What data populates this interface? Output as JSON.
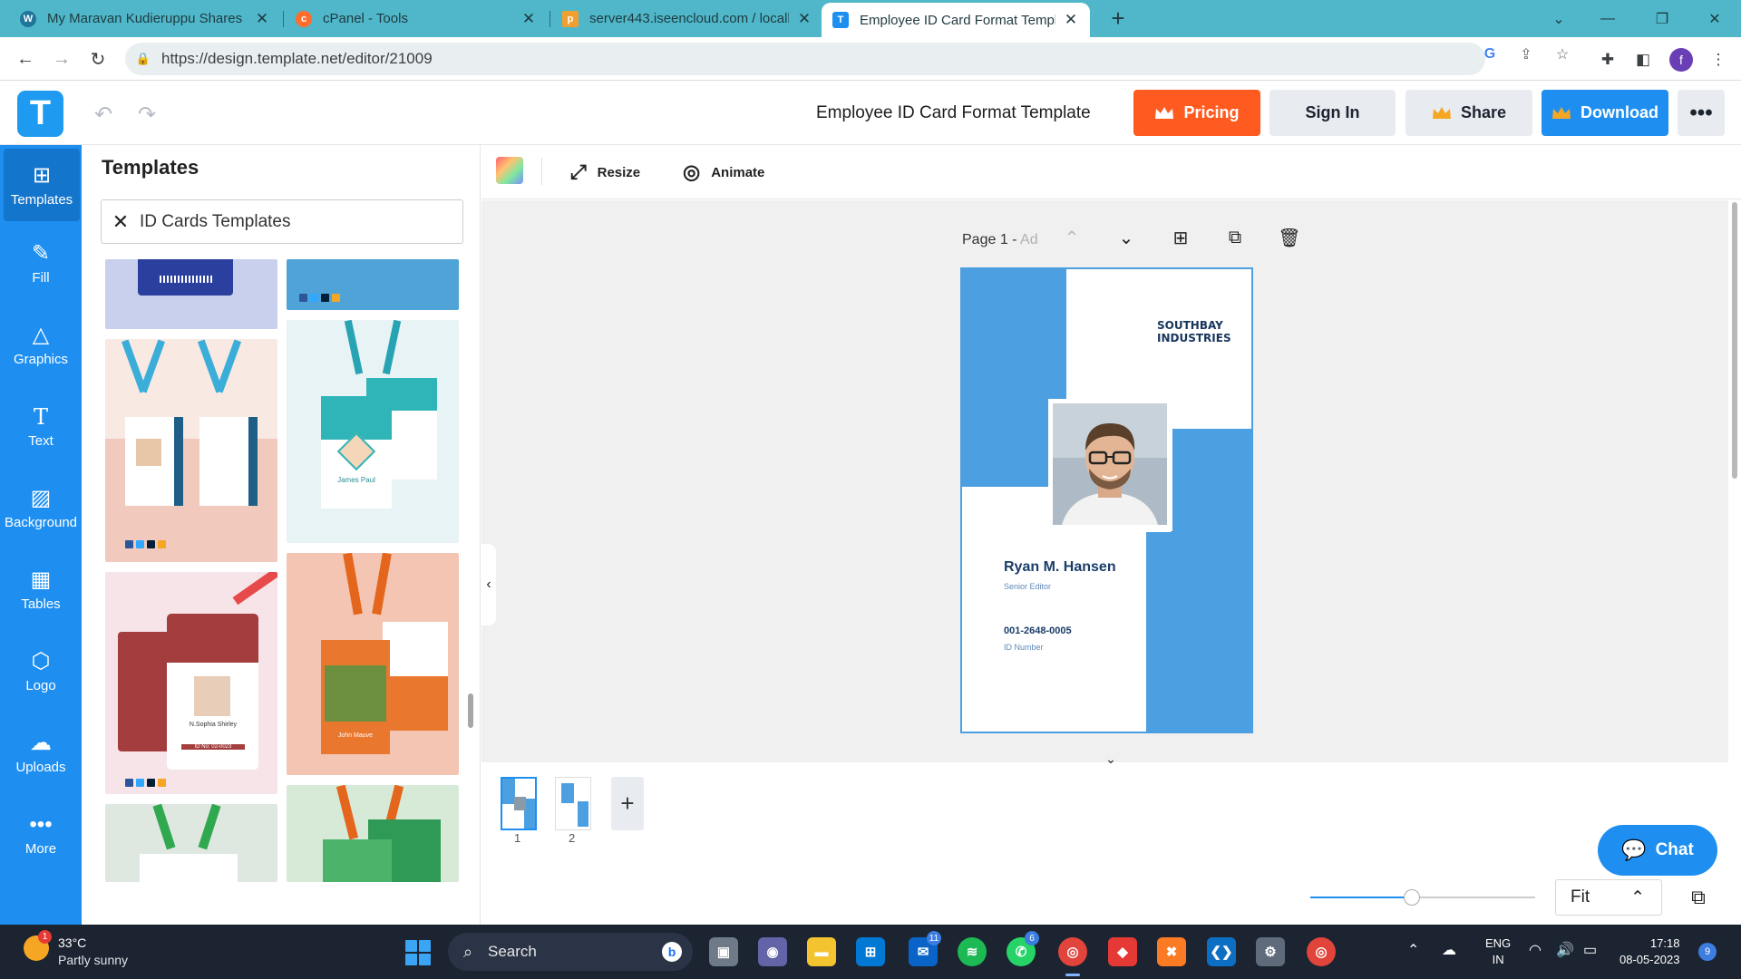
{
  "browser": {
    "tabs": [
      {
        "title": "My Maravan Kudieruppu Shares",
        "icon": "wordpress-icon"
      },
      {
        "title": "cPanel - Tools",
        "icon": "cpanel-icon"
      },
      {
        "title": "server443.iseencloud.com / locall",
        "icon": "phpmyadmin-icon"
      },
      {
        "title": "Employee ID Card Format Templa",
        "icon": "template-icon",
        "active": true
      }
    ],
    "url": "https://design.template.net/editor/21009",
    "profile_initial": "f"
  },
  "editor": {
    "title": "Employee ID Card Format Template",
    "buttons": {
      "pricing": "Pricing",
      "signin": "Sign In",
      "share": "Share",
      "download": "Download",
      "more": "•••"
    },
    "accent_color": "#1e8ff0",
    "pricing_color": "#ff5a1f"
  },
  "rail": {
    "items": [
      {
        "label": "Templates",
        "icon": "templates-icon"
      },
      {
        "label": "Fill",
        "icon": "pencil-icon"
      },
      {
        "label": "Graphics",
        "icon": "shapes-icon"
      },
      {
        "label": "Text",
        "icon": "text-icon"
      },
      {
        "label": "Background",
        "icon": "background-icon"
      },
      {
        "label": "Tables",
        "icon": "table-icon"
      },
      {
        "label": "Logo",
        "icon": "logo-icon"
      },
      {
        "label": "Uploads",
        "icon": "cloud-upload-icon"
      },
      {
        "label": "More",
        "icon": "more-icon"
      }
    ]
  },
  "panel": {
    "title": "Templates",
    "search_value": "ID Cards Templates",
    "thumbs": {
      "teal_name": "James Paul",
      "red_name": "N.Sophia Shirley",
      "red_id": "ID No: 02-0023",
      "orange_name": "John Mauve"
    }
  },
  "toolbar": {
    "resize": "Resize",
    "animate": "Animate"
  },
  "page": {
    "label": "Page 1 - ",
    "placeholder": "Ad"
  },
  "card": {
    "company_line1": "SOUTHBAY",
    "company_line2": "INDUSTRIES",
    "name": "Ryan M. Hansen",
    "role": "Senior Editor",
    "id_number": "001-2648-0005",
    "id_label": "ID Number",
    "blue": "#4c9fe0"
  },
  "pages": [
    {
      "number": "1"
    },
    {
      "number": "2"
    }
  ],
  "zoom": {
    "value": "Fit",
    "level": 0.45
  },
  "chat": {
    "label": "Chat"
  },
  "taskbar": {
    "weather_temp": "33°C",
    "weather_desc": "Partly sunny",
    "weather_badge": "1",
    "search": "Search",
    "lang_top": "ENG",
    "lang_bottom": "IN",
    "time": "17:18",
    "date": "08-05-2023",
    "notif": "9",
    "badge_mail": "11",
    "badge_whatsapp": "6"
  }
}
